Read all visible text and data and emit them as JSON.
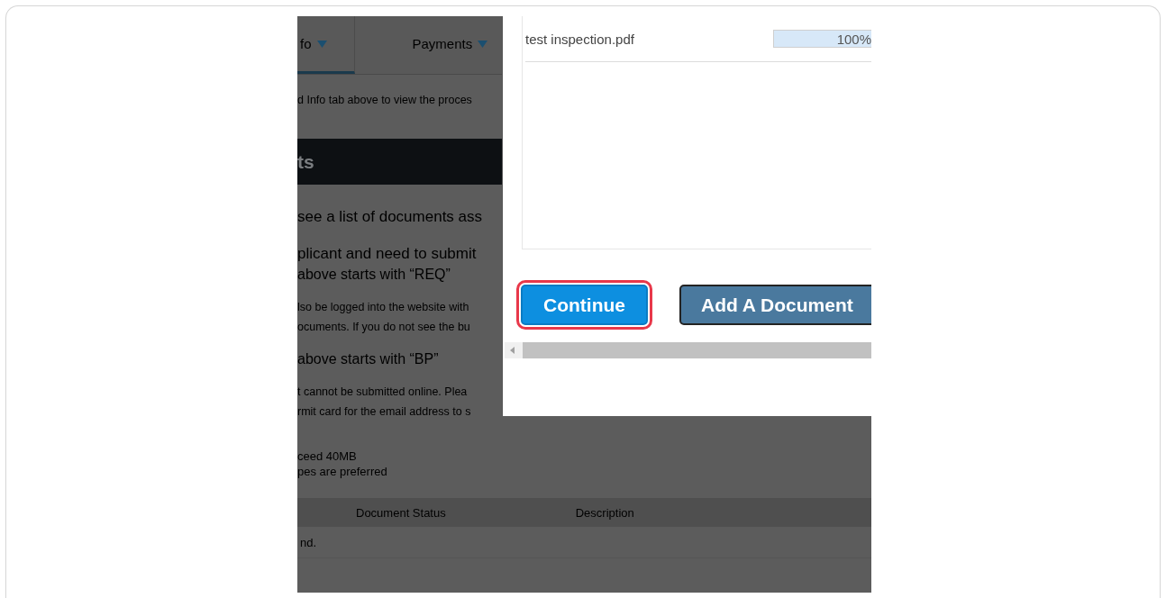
{
  "background_page": {
    "tabs": [
      {
        "label": "fo",
        "selected": true
      },
      {
        "label": "Payments",
        "selected": false
      }
    ],
    "notice": "d Info tab above to view the proces",
    "section_title": "ts",
    "paragraphs": [
      {
        "kind": "lead",
        "text": "see a list of documents ass"
      },
      {
        "kind": "heading",
        "text": "plicant and need to submit"
      },
      {
        "kind": "subheading",
        "text": "above starts with “REQ”"
      },
      {
        "kind": "body",
        "text": "lso be logged into the website with"
      },
      {
        "kind": "body",
        "text": "ocuments. If you do not see the bu"
      },
      {
        "kind": "subheading",
        "text": "above starts with “BP”"
      },
      {
        "kind": "body",
        "text": "t cannot be submitted online. Plea"
      },
      {
        "kind": "body",
        "text": "rmit card for the email address to s"
      },
      {
        "kind": "note",
        "text": "ceed 40MB"
      },
      {
        "kind": "note",
        "text": "pes are preferred"
      }
    ],
    "table": {
      "columns": [
        "Document Status",
        "Description"
      ],
      "rows": [
        "nd."
      ]
    }
  },
  "dialog": {
    "files": [
      {
        "name": "test inspection.pdf",
        "level": 1,
        "reading": "100%"
      }
    ],
    "buttons": [
      {
        "label": "Continue",
        "kind": "primary",
        "highlighted": true
      },
      {
        "label": "Add A Document",
        "kind": "secondary",
        "highlighted": false
      }
    ]
  }
}
